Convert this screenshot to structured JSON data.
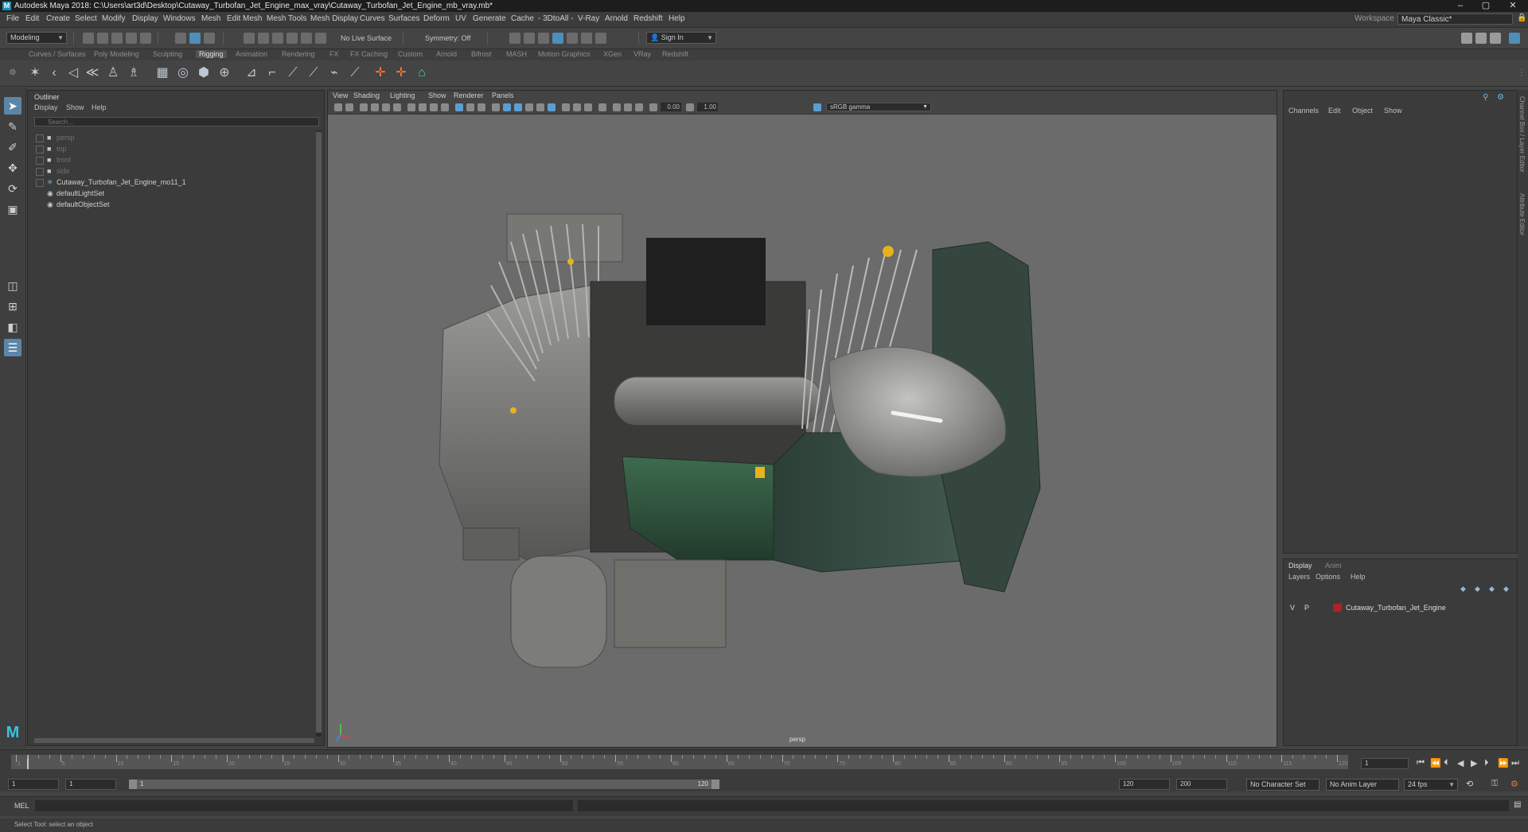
{
  "titlebar": {
    "title": "Autodesk Maya 2018: C:\\Users\\art3d\\Desktop\\Cutaway_Turbofan_Jet_Engine_max_vray\\Cutaway_Turbofan_Jet_Engine_mb_vray.mb*",
    "minimize": "–",
    "maximize": "▢",
    "close": "✕"
  },
  "menubar": {
    "items": [
      "File",
      "Edit",
      "Create",
      "Select",
      "Modify",
      "Display",
      "Windows",
      "Mesh",
      "Edit Mesh",
      "Mesh Tools",
      "Mesh Display",
      "Curves",
      "Surfaces",
      "Deform",
      "UV",
      "Generate",
      "Cache",
      "- 3DtoAll -",
      "V-Ray",
      "Arnold",
      "Redshift",
      "Help"
    ],
    "workspace_label": "Workspace :",
    "workspace_value": "Maya Classic*"
  },
  "statusline": {
    "mode": "Modeling",
    "live_surface": "No Live Surface",
    "symmetry": "Symmetry: Off",
    "sign_in": "Sign In"
  },
  "shelf": {
    "tabs": [
      "Curves / Surfaces",
      "Poly Modeling",
      "Sculpting",
      "Rigging",
      "Animation",
      "Rendering",
      "FX",
      "FX Caching",
      "Custom",
      "Arnold",
      "Bifrost",
      "MASH",
      "Motion Graphics",
      "XGen",
      "VRay",
      "Redshift"
    ],
    "active_tab": "Rigging"
  },
  "outliner": {
    "title": "Outliner",
    "menu": [
      "Display",
      "Show",
      "Help"
    ],
    "search_placeholder": "Search...",
    "cameras": [
      "persp",
      "top",
      "front",
      "side"
    ],
    "root_object": "Cutaway_Turbofan_Jet_Engine_mo11_1",
    "sets": [
      "defaultLightSet",
      "defaultObjectSet"
    ]
  },
  "viewport": {
    "menu": [
      "View",
      "Shading",
      "Lighting",
      "Show",
      "Renderer",
      "Panels"
    ],
    "exposure": "0.00",
    "gamma": "1.00",
    "colorspace": "sRGB gamma",
    "camera": "persp"
  },
  "channelbox": {
    "menu": [
      "Channels",
      "Edit",
      "Object",
      "Show"
    ]
  },
  "layers": {
    "tabs": [
      "Display",
      "Anim"
    ],
    "menu": [
      "Layers",
      "Options",
      "Help"
    ],
    "layer": {
      "v": "V",
      "p": "P",
      "name": "Cutaway_Turbofan_Jet_Engine",
      "color": "#b3202a"
    }
  },
  "sidetabs": [
    "Channel Box / Layer Editor",
    "Attribute Editor"
  ],
  "timeslider": {
    "labels": [
      "1",
      "5",
      "10",
      "15",
      "20",
      "25",
      "30",
      "35",
      "40",
      "45",
      "50",
      "55",
      "60",
      "65",
      "70",
      "75",
      "80",
      "85",
      "90",
      "95",
      "100",
      "105",
      "110",
      "115",
      "120"
    ],
    "current_frame": "1"
  },
  "range": {
    "start": "1",
    "playback_start": "1",
    "range_in": "1",
    "range_out": "120",
    "playback_end": "120",
    "end": "200",
    "character_set": "No Character Set",
    "anim_layer": "No Anim Layer",
    "fps": "24 fps"
  },
  "mel": {
    "label": "MEL"
  },
  "help": {
    "text": "Select Tool: select an object"
  }
}
